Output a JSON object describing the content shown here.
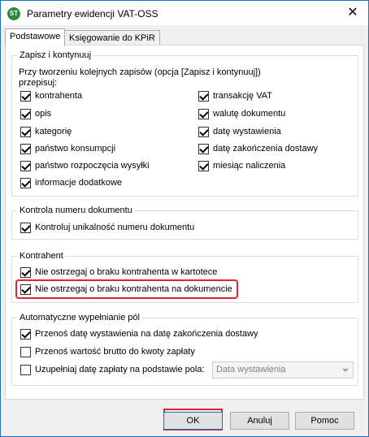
{
  "window": {
    "title": "Parametry ewidencji VAT-OSS",
    "icon_label": "ST",
    "close_glyph": "✕"
  },
  "tabs": [
    {
      "label": "Podstawowe",
      "active": true
    },
    {
      "label": "Księgowanie do KPiR",
      "active": false
    }
  ],
  "zapisz": {
    "legend": "Zapisz i kontynuuj",
    "info_line1": "Przy tworzeniu kolejnych zapisów (opcja [Zapisz i kontynuuj])",
    "info_line2": "przepisuj:",
    "left": [
      {
        "label": "kontrahenta",
        "checked": true
      },
      {
        "label": "opis",
        "checked": true
      },
      {
        "label": "kategorię",
        "checked": true
      },
      {
        "label": "państwo konsumpcji",
        "checked": true
      },
      {
        "label": "państwo rozpoczęcia wysyłki",
        "checked": true
      },
      {
        "label": "informacje dodatkowe",
        "checked": true
      }
    ],
    "right": [
      {
        "label": "transakcję VAT",
        "checked": true
      },
      {
        "label": "walutę dokumentu",
        "checked": true
      },
      {
        "label": "datę wystawienia",
        "checked": true
      },
      {
        "label": "datę zakończenia dostawy",
        "checked": true
      },
      {
        "label": "miesiąc naliczenia",
        "checked": true
      }
    ]
  },
  "kontrola": {
    "legend": "Kontrola numeru dokumentu",
    "items": [
      {
        "label": "Kontroluj unikalność numeru dokumentu",
        "checked": true
      }
    ]
  },
  "kontrahent": {
    "legend": "Kontrahent",
    "items": [
      {
        "label": "Nie ostrzegaj o braku kontrahenta w kartotece",
        "checked": true
      },
      {
        "label": "Nie ostrzegaj o braku kontrahenta na dokumencie",
        "checked": true
      }
    ]
  },
  "auto": {
    "legend": "Automatyczne wypełnianie pól",
    "items": [
      {
        "label": "Przenoś datę wystawienia na datę zakończenia dostawy",
        "checked": true
      },
      {
        "label": "Przenoś wartość brutto do kwoty zapłaty",
        "checked": false
      },
      {
        "label": "Uzupełniaj datę zapłaty na podstawie pola:",
        "checked": false
      }
    ],
    "select_value": "Data wystawienia"
  },
  "buttons": {
    "ok": "OK",
    "cancel": "Anuluj",
    "help": "Pomoc"
  },
  "colors": {
    "highlight": "#e0262a",
    "window_border": "#1a6fc4"
  }
}
